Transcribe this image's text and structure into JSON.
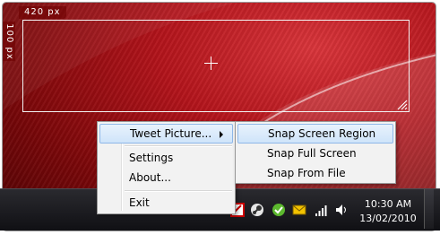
{
  "selection": {
    "width_label": "420 px",
    "height_label": "100 px"
  },
  "context_menu": {
    "items": [
      {
        "label": "Tweet Picture...",
        "has_submenu": true,
        "highlighted": true
      },
      {
        "label": "Settings"
      },
      {
        "label": "About..."
      },
      {
        "label": "Exit"
      }
    ]
  },
  "submenu": {
    "items": [
      {
        "label": "Snap Screen Region",
        "highlighted": true
      },
      {
        "label": "Snap Full Screen"
      },
      {
        "label": "Snap From File"
      }
    ]
  },
  "taskbar": {
    "tray_icons": [
      "tweet-screenshot-icon",
      "steam-icon",
      "chat-icon",
      "mail-icon",
      "signal-icon",
      "volume-icon"
    ],
    "clock": {
      "time": "10:30 AM",
      "date": "13/02/2010"
    }
  },
  "colors": {
    "desktop": "#b3141b",
    "menu_highlight": "#cfe4fa",
    "taskbar": "#1b1b20"
  }
}
